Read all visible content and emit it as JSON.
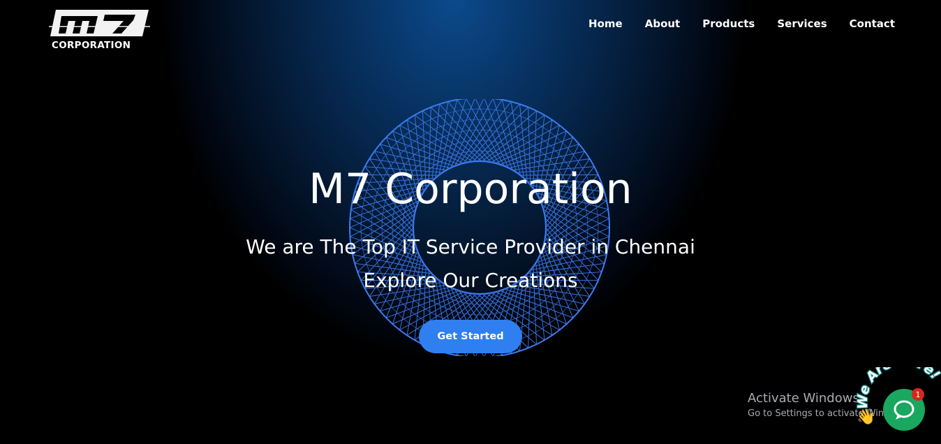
{
  "header": {
    "logo": {
      "mark": "m7",
      "sub": "CORPORATION"
    },
    "nav": [
      "Home",
      "About",
      "Products",
      "Services",
      "Contact"
    ]
  },
  "hero": {
    "title": "M7 Corporation",
    "subtitle_line1": "We are The Top IT Service Provider in Chennai",
    "subtitle_line2": "Explore Our Creations",
    "cta_label": "Get Started"
  },
  "watermark": {
    "title": "Activate Windows",
    "subtitle": "Go to Settings to activate Windows."
  },
  "chat": {
    "banner": "We Are Here!",
    "badge_count": "1"
  },
  "colors": {
    "accent": "#2f7ff0",
    "ring": "#3d7bf0",
    "chat": "#1aa760",
    "badge": "#d9261c"
  }
}
